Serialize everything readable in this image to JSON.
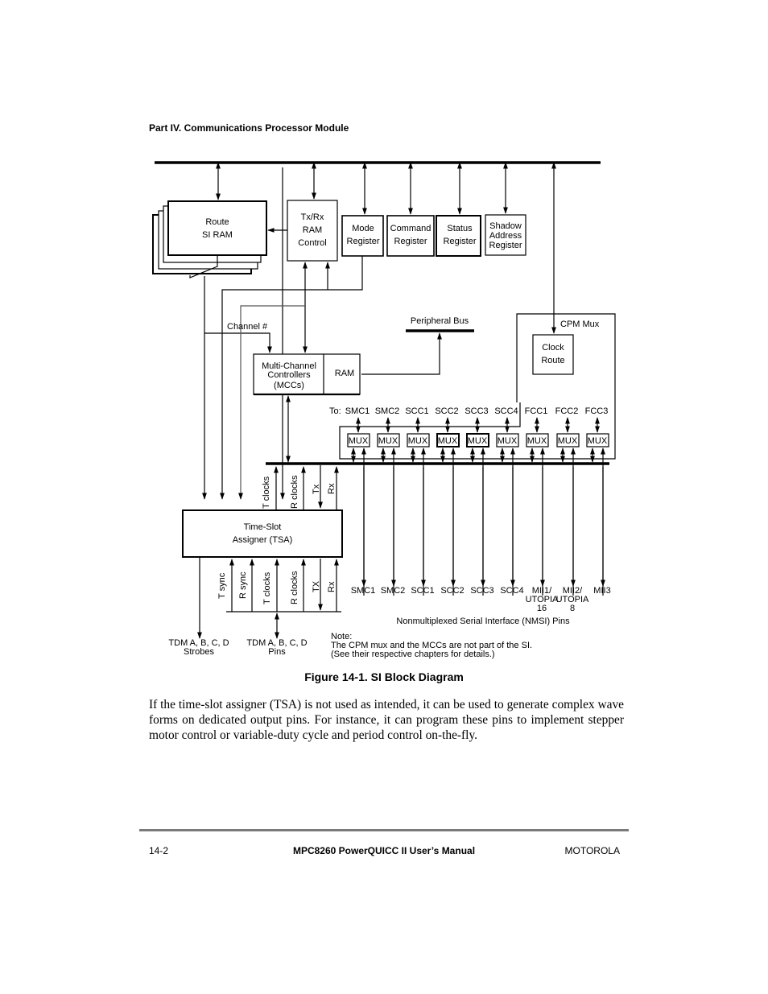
{
  "page": {
    "header": "Part IV.  Communications Processor Module",
    "figure_caption": "Figure 14-1. SI Block Diagram",
    "body_paragraph": "If the time-slot assigner (TSA) is not used as intended, it can be used to generate complex wave forms on dedicated output pins. For instance, it can program these pins to implement stepper motor control or variable-duty cycle and period control on-the-fly.",
    "footer": {
      "page_number": "14-2",
      "manual_title": "MPC8260 PowerQUICC II User’s Manual",
      "company": "MOTOROLA"
    }
  },
  "diagram": {
    "route_si_ram": [
      "Route",
      "SI RAM"
    ],
    "txrx_ram_control": [
      "Tx/Rx",
      "RAM",
      "Control"
    ],
    "mode_register": [
      "Mode",
      "Register"
    ],
    "command_register": [
      "Command",
      "Register"
    ],
    "status_register": [
      "Status",
      "Register"
    ],
    "shadow_address_register": [
      "Shadow",
      "Address",
      "Register"
    ],
    "channel_label": "Channel #",
    "peripheral_bus": "Peripheral Bus",
    "cpm_mux": "CPM Mux",
    "clock_route": [
      "Clock",
      "Route"
    ],
    "mcc": [
      "Multi-Channel",
      "Controllers",
      "(MCCs)"
    ],
    "mcc_ram": "RAM",
    "to_label": "To:",
    "to_targets": [
      "SMC1",
      "SMC2",
      "SCC1",
      "SCC2",
      "SCC3",
      "SCC4",
      "FCC1",
      "FCC2",
      "FCC3"
    ],
    "mux_label": "MUX",
    "tsa": [
      "Time-Slot",
      "Assigner (TSA)"
    ],
    "tsa_top_signals": [
      "T clocks",
      "R clocks",
      "Tx",
      "Rx"
    ],
    "tsa_bottom_signals": [
      "T sync",
      "R sync",
      "T clocks",
      "R clocks",
      "TX",
      "Rx"
    ],
    "nmsi_pins": [
      [
        "SMC1"
      ],
      [
        "SMC2"
      ],
      [
        "SCC1"
      ],
      [
        "SCC2"
      ],
      [
        "SCC3"
      ],
      [
        "SCC4"
      ],
      [
        "MII1/",
        "UTOPIA",
        "16"
      ],
      [
        "MII2/",
        "UTOPIA",
        "8"
      ],
      [
        "MII3"
      ]
    ],
    "nmsi_label": "Nonmultiplexed Serial Interface (NMSI) Pins",
    "tdm_strobes": [
      "TDM A, B, C, D",
      "Strobes"
    ],
    "tdm_pins": [
      "TDM A, B, C, D",
      "Pins"
    ],
    "note": [
      "Note:",
      "The CPM mux and the MCCs are not part of the SI.",
      "(See their respective chapters for details.)"
    ]
  }
}
